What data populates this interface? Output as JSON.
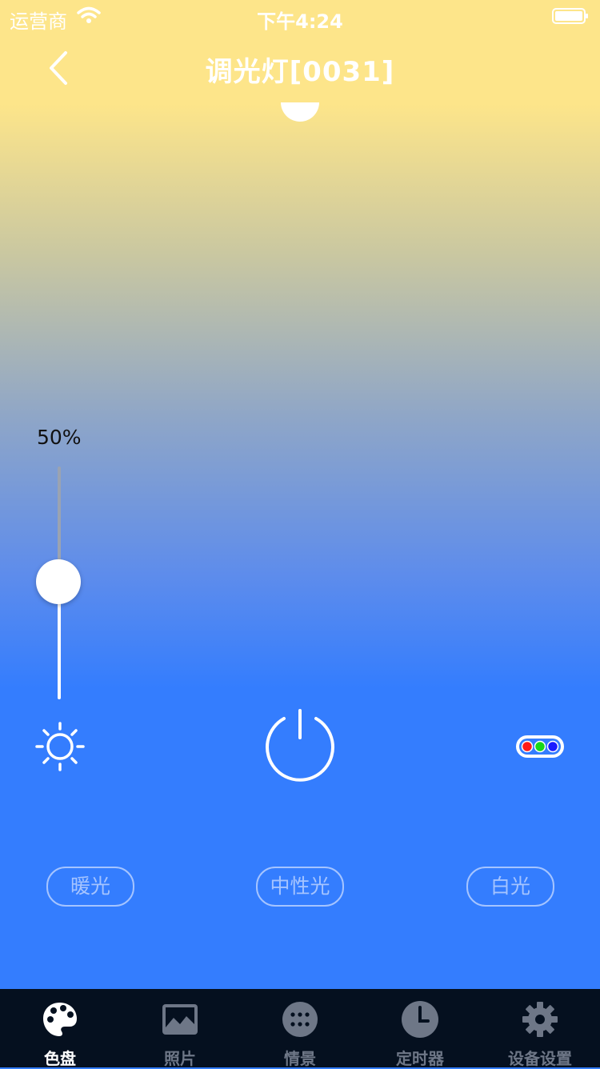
{
  "status_bar": {
    "carrier": "运营商",
    "time": "下午4:24"
  },
  "nav": {
    "title": "调光灯[0031]"
  },
  "brightness": {
    "label": "50%",
    "value_percent": 50
  },
  "presets": [
    {
      "label": "暖光"
    },
    {
      "label": "中性光"
    },
    {
      "label": "白光"
    }
  ],
  "tabs": [
    {
      "label": "色盘",
      "icon": "palette-icon",
      "active": true
    },
    {
      "label": "照片",
      "icon": "photo-icon",
      "active": false
    },
    {
      "label": "情景",
      "icon": "scene-grid-icon",
      "active": false
    },
    {
      "label": "定时器",
      "icon": "clock-icon",
      "active": false
    },
    {
      "label": "设备设置",
      "icon": "gear-icon",
      "active": false
    }
  ],
  "colors": {
    "top_warm": "#fde58a",
    "bottom_blue": "#347dfe",
    "tabbar_bg": "#05101f",
    "preset_outline": "#a5c4ff"
  }
}
